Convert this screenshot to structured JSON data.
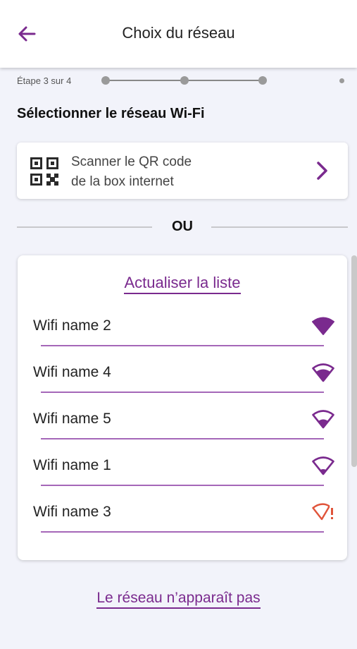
{
  "header": {
    "title": "Choix du réseau",
    "back_icon": "arrow-left-icon"
  },
  "colors": {
    "accent": "#7a2a8e",
    "warning": "#e0543a",
    "background": "#f2f3fa"
  },
  "stepper": {
    "label": "Étape 3 sur 4",
    "current": 3,
    "total": 4
  },
  "section_title": "Sélectionner le réseau Wi-Fi",
  "qr_card": {
    "line1": "Scanner le QR code",
    "line2": "de la box internet",
    "icon": "qr-code-icon",
    "chevron": "chevron-right-icon"
  },
  "separator": "OU",
  "wifi_list": {
    "refresh_label": "Actualiser la liste",
    "items": [
      {
        "name": "Wifi name 2",
        "signal": 4,
        "warning": false
      },
      {
        "name": "Wifi name 4",
        "signal": 3,
        "warning": false
      },
      {
        "name": "Wifi name 5",
        "signal": 2,
        "warning": false
      },
      {
        "name": "Wifi name 1",
        "signal": 1,
        "warning": false
      },
      {
        "name": "Wifi name 3",
        "signal": 0,
        "warning": true
      }
    ]
  },
  "bottom_link": "Le réseau n’apparaît pas"
}
